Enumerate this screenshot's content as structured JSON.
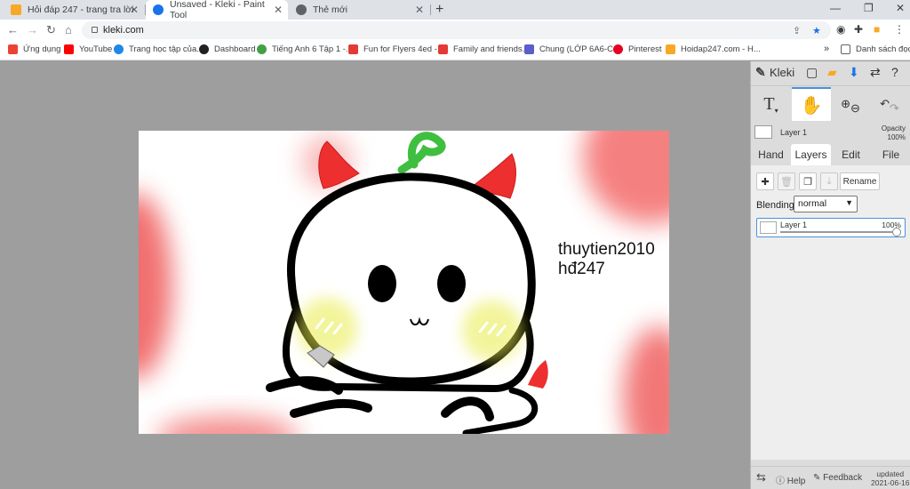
{
  "browser": {
    "tabs": [
      {
        "title": "Hỏi đáp 247 - trang tra lời",
        "favicon": "hoidap-icon",
        "active": false
      },
      {
        "title": "Unsaved - Kleki - Paint Tool",
        "favicon": "kleki-icon",
        "active": true
      },
      {
        "title": "Thẻ mới",
        "favicon": "chrome-icon",
        "active": false
      }
    ],
    "new_tab": "+",
    "url": "kleki.com"
  },
  "bookmarks": [
    {
      "label": "Ứng dụng",
      "icon": "apps-grid-icon",
      "color": "#ea4335"
    },
    {
      "label": "YouTube",
      "icon": "youtube-icon",
      "color": "#ff0000"
    },
    {
      "label": "Trang học tập của...",
      "icon": "cloud-icon",
      "color": "#1e88e5"
    },
    {
      "label": "Dashboard",
      "icon": "dashboard-icon",
      "color": "#212121"
    },
    {
      "label": "Tiếng Anh 6 Tập 1 -...",
      "icon": "globe-icon",
      "color": "#43a047"
    },
    {
      "label": "Fun for Flyers 4ed -...",
      "icon": "shield-icon",
      "color": "#e53935"
    },
    {
      "label": "Family and friends...",
      "icon": "shield-icon",
      "color": "#e53935"
    },
    {
      "label": "Chung (LỚP 6A6-C...",
      "icon": "teams-icon",
      "color": "#5b5fc7"
    },
    {
      "label": "Pinterest",
      "icon": "pinterest-icon",
      "color": "#e60023"
    },
    {
      "label": "Hoidap247.com - H...",
      "icon": "hoidap-icon",
      "color": "#f9a825"
    }
  ],
  "bookmarks_more": "»",
  "reading_list": "Danh sách đọc",
  "kleki": {
    "app_name": "Kleki",
    "layer_name": "Layer 1",
    "opacity_label": "Opacity",
    "opacity_value": "100%",
    "panel_tabs": [
      "Hand",
      "Layers",
      "Edit",
      "File"
    ],
    "active_tab": "Layers",
    "rename_label": "Rename",
    "blending_label": "Blending",
    "blending_value": "normal",
    "layer_row": {
      "name": "Layer 1",
      "opacity": "100%"
    },
    "footer": {
      "help": "Help",
      "feedback": "Feedback",
      "updated_label": "updated",
      "updated_date": "2021-06-16"
    }
  },
  "artwork": {
    "text_line1": "thuytien2010",
    "text_line2": "hđ247"
  },
  "colors": {
    "accent": "#4a90d9",
    "active_tab_favicon": "#1a73e8"
  }
}
